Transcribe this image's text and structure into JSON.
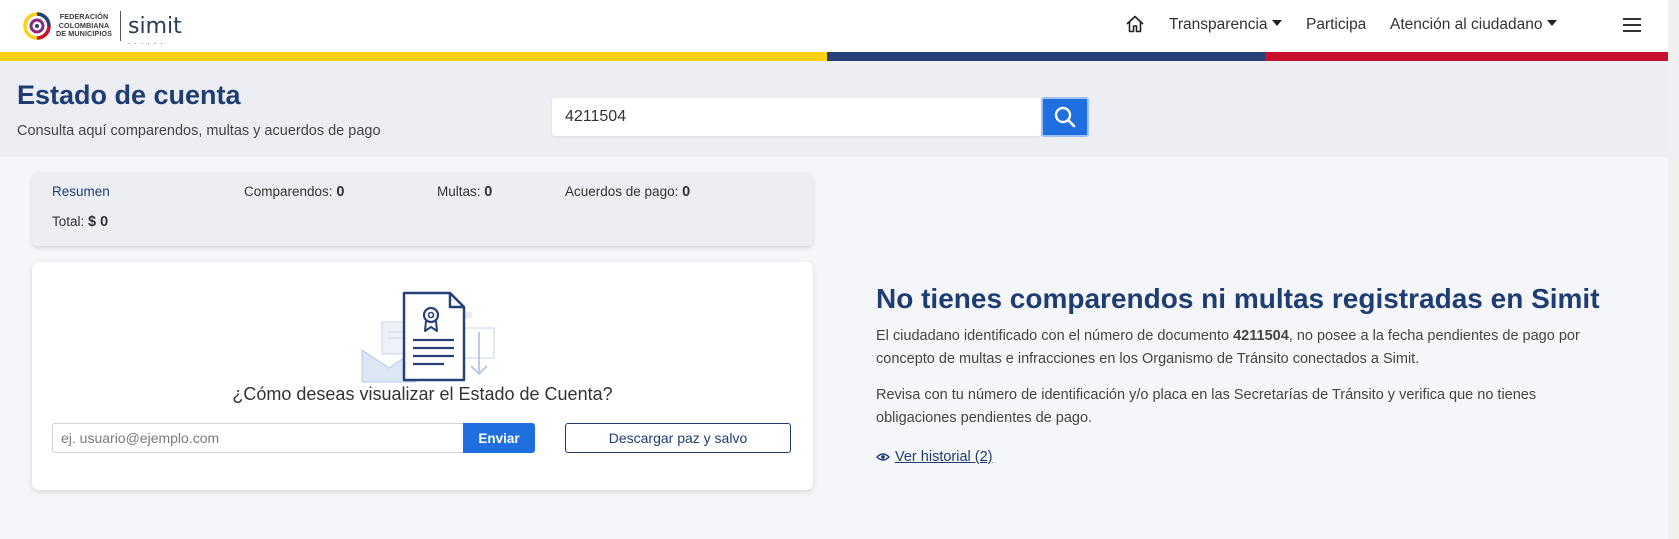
{
  "header": {
    "logo_text_line1": "FEDERACIÓN",
    "logo_text_line2": "COLOMBIANA",
    "logo_text_line3": "DE MUNICIPIOS",
    "brand": "simit",
    "nav": {
      "home_icon": "home-icon",
      "transparencia": "Transparencia",
      "participa": "Participa",
      "atencion": "Atención al ciudadano",
      "menu_icon": "hamburger-menu-icon"
    },
    "colors": {
      "yellow": "#fcd116",
      "blue": "#27407a",
      "red": "#c8102e"
    }
  },
  "hero": {
    "title": "Estado de cuenta",
    "subtitle": "Consulta aquí comparendos, multas y acuerdos de pago",
    "search_value": "4211504",
    "search_icon": "search-icon"
  },
  "summary": {
    "resumen_label": "Resumen",
    "comparendos_label": "Comparendos:",
    "comparendos_value": "0",
    "multas_label": "Multas:",
    "multas_value": "0",
    "acuerdos_label": "Acuerdos de pago:",
    "acuerdos_value": "0",
    "total_label": "Total:",
    "total_value": "$ 0"
  },
  "card": {
    "illustration_icon": "certificate-document-icon",
    "question": "¿Cómo deseas visualizar el Estado de Cuenta?",
    "email_placeholder": "ej. usuario@ejemplo.com",
    "enviar_label": "Enviar",
    "descargar_label": "Descargar paz y salvo"
  },
  "result": {
    "title": "No tienes comparendos ni multas registradas en Simit",
    "p1_before": "El ciudadano identificado con el número de documento ",
    "p1_doc": "4211504",
    "p1_after": ", no posee a la fecha pendientes de pago por concepto de multas e infracciones en los Organismo de Tránsito conectados a Simit.",
    "p2": "Revisa con tu número de identificación y/o placa en las Secretarías de Tránsito y verifica que no tienes obligaciones pendientes de pago.",
    "historial_icon": "eye-icon",
    "historial_label": "Ver historial (2)"
  },
  "accent_color": "#1f3d72",
  "button_color": "#1f6fe0"
}
